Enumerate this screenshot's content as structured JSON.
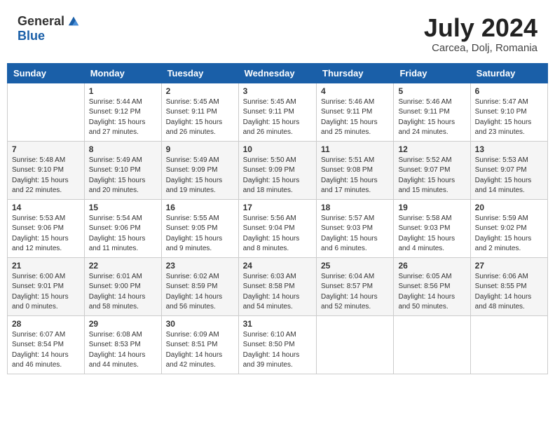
{
  "header": {
    "logo_general": "General",
    "logo_blue": "Blue",
    "month_year": "July 2024",
    "location": "Carcea, Dolj, Romania"
  },
  "days_of_week": [
    "Sunday",
    "Monday",
    "Tuesday",
    "Wednesday",
    "Thursday",
    "Friday",
    "Saturday"
  ],
  "weeks": [
    [
      {
        "day": "",
        "info": ""
      },
      {
        "day": "1",
        "info": "Sunrise: 5:44 AM\nSunset: 9:12 PM\nDaylight: 15 hours\nand 27 minutes."
      },
      {
        "day": "2",
        "info": "Sunrise: 5:45 AM\nSunset: 9:11 PM\nDaylight: 15 hours\nand 26 minutes."
      },
      {
        "day": "3",
        "info": "Sunrise: 5:45 AM\nSunset: 9:11 PM\nDaylight: 15 hours\nand 26 minutes."
      },
      {
        "day": "4",
        "info": "Sunrise: 5:46 AM\nSunset: 9:11 PM\nDaylight: 15 hours\nand 25 minutes."
      },
      {
        "day": "5",
        "info": "Sunrise: 5:46 AM\nSunset: 9:11 PM\nDaylight: 15 hours\nand 24 minutes."
      },
      {
        "day": "6",
        "info": "Sunrise: 5:47 AM\nSunset: 9:10 PM\nDaylight: 15 hours\nand 23 minutes."
      }
    ],
    [
      {
        "day": "7",
        "info": "Sunrise: 5:48 AM\nSunset: 9:10 PM\nDaylight: 15 hours\nand 22 minutes."
      },
      {
        "day": "8",
        "info": "Sunrise: 5:49 AM\nSunset: 9:10 PM\nDaylight: 15 hours\nand 20 minutes."
      },
      {
        "day": "9",
        "info": "Sunrise: 5:49 AM\nSunset: 9:09 PM\nDaylight: 15 hours\nand 19 minutes."
      },
      {
        "day": "10",
        "info": "Sunrise: 5:50 AM\nSunset: 9:09 PM\nDaylight: 15 hours\nand 18 minutes."
      },
      {
        "day": "11",
        "info": "Sunrise: 5:51 AM\nSunset: 9:08 PM\nDaylight: 15 hours\nand 17 minutes."
      },
      {
        "day": "12",
        "info": "Sunrise: 5:52 AM\nSunset: 9:07 PM\nDaylight: 15 hours\nand 15 minutes."
      },
      {
        "day": "13",
        "info": "Sunrise: 5:53 AM\nSunset: 9:07 PM\nDaylight: 15 hours\nand 14 minutes."
      }
    ],
    [
      {
        "day": "14",
        "info": "Sunrise: 5:53 AM\nSunset: 9:06 PM\nDaylight: 15 hours\nand 12 minutes."
      },
      {
        "day": "15",
        "info": "Sunrise: 5:54 AM\nSunset: 9:06 PM\nDaylight: 15 hours\nand 11 minutes."
      },
      {
        "day": "16",
        "info": "Sunrise: 5:55 AM\nSunset: 9:05 PM\nDaylight: 15 hours\nand 9 minutes."
      },
      {
        "day": "17",
        "info": "Sunrise: 5:56 AM\nSunset: 9:04 PM\nDaylight: 15 hours\nand 8 minutes."
      },
      {
        "day": "18",
        "info": "Sunrise: 5:57 AM\nSunset: 9:03 PM\nDaylight: 15 hours\nand 6 minutes."
      },
      {
        "day": "19",
        "info": "Sunrise: 5:58 AM\nSunset: 9:03 PM\nDaylight: 15 hours\nand 4 minutes."
      },
      {
        "day": "20",
        "info": "Sunrise: 5:59 AM\nSunset: 9:02 PM\nDaylight: 15 hours\nand 2 minutes."
      }
    ],
    [
      {
        "day": "21",
        "info": "Sunrise: 6:00 AM\nSunset: 9:01 PM\nDaylight: 15 hours\nand 0 minutes."
      },
      {
        "day": "22",
        "info": "Sunrise: 6:01 AM\nSunset: 9:00 PM\nDaylight: 14 hours\nand 58 minutes."
      },
      {
        "day": "23",
        "info": "Sunrise: 6:02 AM\nSunset: 8:59 PM\nDaylight: 14 hours\nand 56 minutes."
      },
      {
        "day": "24",
        "info": "Sunrise: 6:03 AM\nSunset: 8:58 PM\nDaylight: 14 hours\nand 54 minutes."
      },
      {
        "day": "25",
        "info": "Sunrise: 6:04 AM\nSunset: 8:57 PM\nDaylight: 14 hours\nand 52 minutes."
      },
      {
        "day": "26",
        "info": "Sunrise: 6:05 AM\nSunset: 8:56 PM\nDaylight: 14 hours\nand 50 minutes."
      },
      {
        "day": "27",
        "info": "Sunrise: 6:06 AM\nSunset: 8:55 PM\nDaylight: 14 hours\nand 48 minutes."
      }
    ],
    [
      {
        "day": "28",
        "info": "Sunrise: 6:07 AM\nSunset: 8:54 PM\nDaylight: 14 hours\nand 46 minutes."
      },
      {
        "day": "29",
        "info": "Sunrise: 6:08 AM\nSunset: 8:53 PM\nDaylight: 14 hours\nand 44 minutes."
      },
      {
        "day": "30",
        "info": "Sunrise: 6:09 AM\nSunset: 8:51 PM\nDaylight: 14 hours\nand 42 minutes."
      },
      {
        "day": "31",
        "info": "Sunrise: 6:10 AM\nSunset: 8:50 PM\nDaylight: 14 hours\nand 39 minutes."
      },
      {
        "day": "",
        "info": ""
      },
      {
        "day": "",
        "info": ""
      },
      {
        "day": "",
        "info": ""
      }
    ]
  ]
}
